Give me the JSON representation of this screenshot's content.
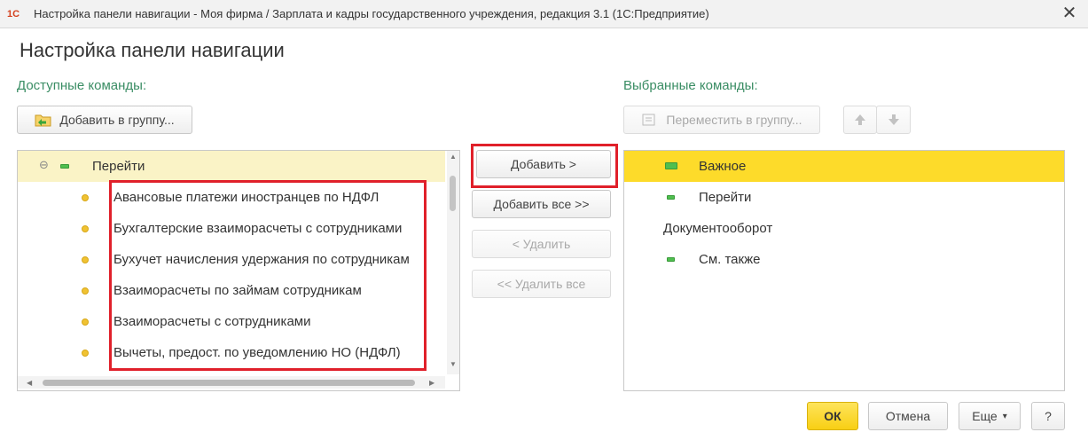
{
  "window": {
    "app_logo": "1С",
    "title": "Настройка панели навигации - Моя фирма / Зарплата и кадры государственного учреждения, редакция 3.1  (1С:Предприятие)",
    "close_glyph": "✕"
  },
  "form": {
    "title": "Настройка панели навигации"
  },
  "available": {
    "label": "Доступные команды:",
    "add_to_group_button": "Добавить в группу...",
    "group": {
      "expander": "⊖",
      "label": "Перейти"
    },
    "items": [
      "Авансовые платежи иностранцев по НДФЛ",
      "Бухгалтерские взаиморасчеты с сотрудниками",
      "Бухучет начисления удержания по сотрудникам",
      "Взаиморасчеты по займам сотрудникам",
      "Взаиморасчеты с сотрудниками",
      "Вычеты, предост. по уведомлению НО (НДФЛ)"
    ]
  },
  "middle": {
    "add_button": "Добавить >",
    "add_all_button": "Добавить все >>",
    "remove_button": "< Удалить",
    "remove_all_button": "<< Удалить все"
  },
  "selected": {
    "label": "Выбранные команды:",
    "move_to_group_button": "Переместить в группу...",
    "items": [
      {
        "label": "Важное",
        "icon": "green-bar-icon",
        "selected": true
      },
      {
        "label": "Перейти",
        "icon": "green-bar-icon",
        "selected": false
      },
      {
        "label": "Документооборот",
        "icon": "",
        "selected": false
      },
      {
        "label": "См. также",
        "icon": "green-bar-icon",
        "selected": false
      }
    ]
  },
  "footer": {
    "ok_button": "ОК",
    "cancel_button": "Отмена",
    "more_button": "Еще",
    "more_caret": "▾",
    "help_button": "?"
  },
  "colors": {
    "accent_green": "#3a8d64",
    "selection_yellow": "#fddb2a",
    "highlight_red": "#e0202a",
    "ok_button": "#fcd82a"
  }
}
